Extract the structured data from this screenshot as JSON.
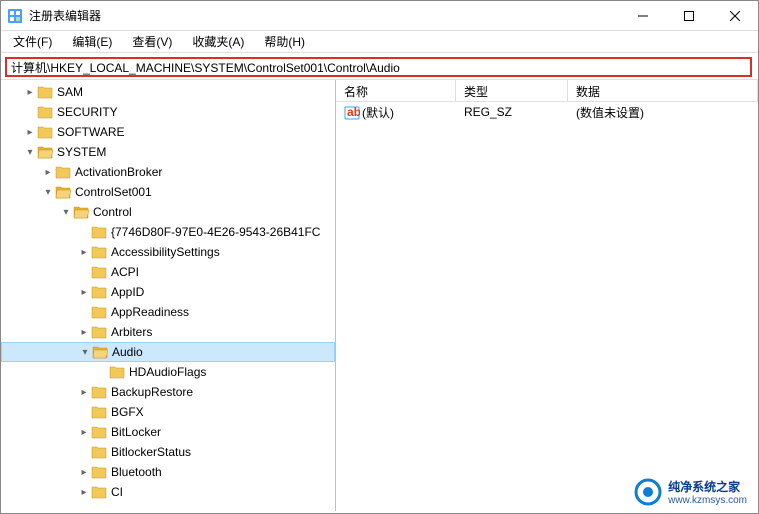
{
  "window": {
    "title": "注册表编辑器"
  },
  "menu": {
    "file": "文件(F)",
    "edit": "编辑(E)",
    "view": "查看(V)",
    "favorites": "收藏夹(A)",
    "help": "帮助(H)"
  },
  "address": "计算机\\HKEY_LOCAL_MACHINE\\SYSTEM\\ControlSet001\\Control\\Audio",
  "tree": {
    "items": [
      {
        "indent": 1,
        "exp": ">",
        "label": "SAM"
      },
      {
        "indent": 1,
        "exp": "",
        "label": "SECURITY"
      },
      {
        "indent": 1,
        "exp": ">",
        "label": "SOFTWARE"
      },
      {
        "indent": 1,
        "exp": "v",
        "label": "SYSTEM"
      },
      {
        "indent": 2,
        "exp": ">",
        "label": "ActivationBroker"
      },
      {
        "indent": 2,
        "exp": "v",
        "label": "ControlSet001"
      },
      {
        "indent": 3,
        "exp": "v",
        "label": "Control"
      },
      {
        "indent": 4,
        "exp": "",
        "label": "{7746D80F-97E0-4E26-9543-26B41FC"
      },
      {
        "indent": 4,
        "exp": ">",
        "label": "AccessibilitySettings"
      },
      {
        "indent": 4,
        "exp": "",
        "label": "ACPI"
      },
      {
        "indent": 4,
        "exp": ">",
        "label": "AppID"
      },
      {
        "indent": 4,
        "exp": "",
        "label": "AppReadiness"
      },
      {
        "indent": 4,
        "exp": ">",
        "label": "Arbiters"
      },
      {
        "indent": 4,
        "exp": "v",
        "label": "Audio",
        "selected": true
      },
      {
        "indent": 5,
        "exp": "",
        "label": "HDAudioFlags"
      },
      {
        "indent": 4,
        "exp": ">",
        "label": "BackupRestore"
      },
      {
        "indent": 4,
        "exp": "",
        "label": "BGFX"
      },
      {
        "indent": 4,
        "exp": ">",
        "label": "BitLocker"
      },
      {
        "indent": 4,
        "exp": "",
        "label": "BitlockerStatus"
      },
      {
        "indent": 4,
        "exp": ">",
        "label": "Bluetooth"
      },
      {
        "indent": 4,
        "exp": ">",
        "label": "CI"
      }
    ]
  },
  "list": {
    "headers": {
      "name": "名称",
      "type": "类型",
      "data": "数据"
    },
    "rows": [
      {
        "name": "(默认)",
        "type": "REG_SZ",
        "data": "(数值未设置)"
      }
    ]
  },
  "watermark": {
    "site": "纯净系统之家",
    "url": "www.kzmsys.com"
  }
}
